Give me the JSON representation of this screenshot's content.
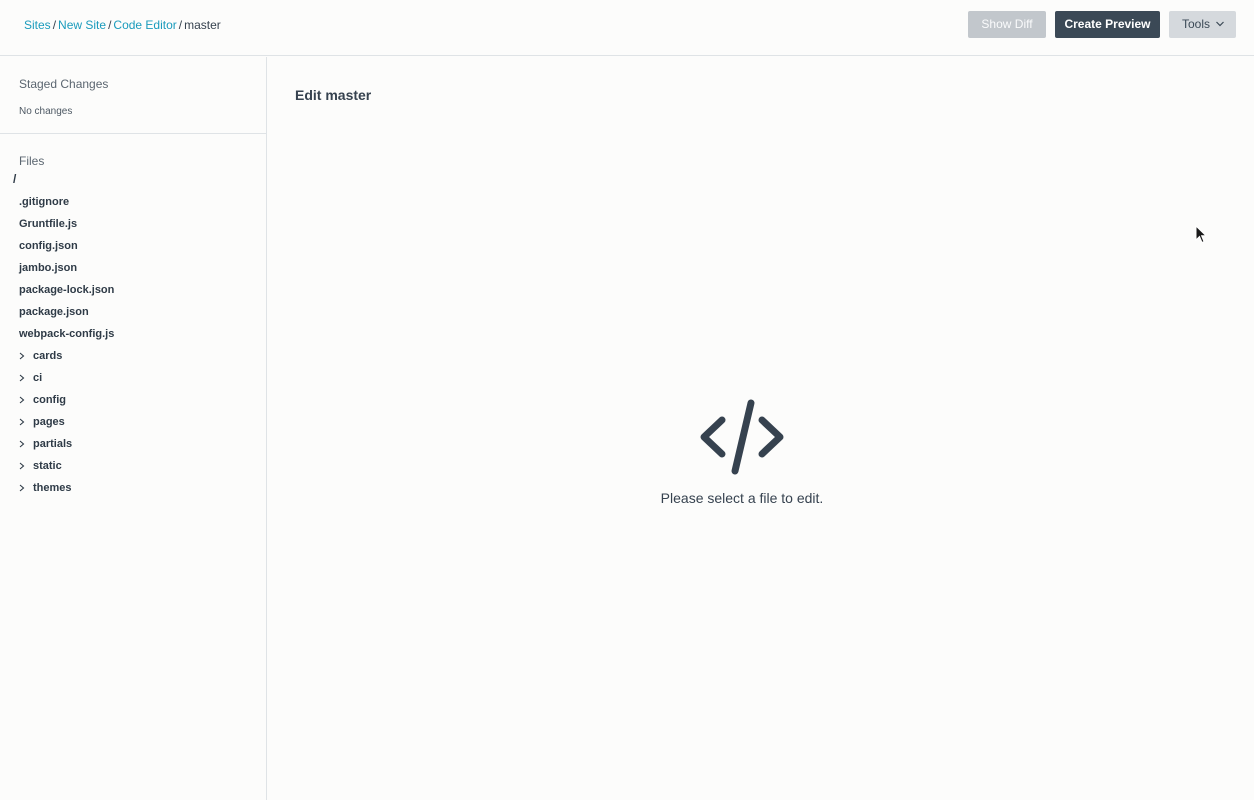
{
  "breadcrumb": {
    "items": [
      "Sites",
      "New Site",
      "Code Editor"
    ],
    "separator": "/",
    "current": "master"
  },
  "toolbar": {
    "show_diff": "Show Diff",
    "create_preview": "Create Preview",
    "tools": "Tools"
  },
  "sidebar": {
    "staged_title": "Staged Changes",
    "no_changes": "No changes",
    "files_title": "Files",
    "root": "/",
    "files": [
      ".gitignore",
      "Gruntfile.js",
      "config.json",
      "jambo.json",
      "package-lock.json",
      "package.json",
      "webpack-config.js"
    ],
    "folders": [
      "cards",
      "ci",
      "config",
      "pages",
      "partials",
      "static",
      "themes"
    ]
  },
  "main": {
    "title": "Edit master",
    "empty_message": "Please select a file to edit.",
    "empty_icon": "code-icon"
  },
  "colors": {
    "link": "#1a9bbc",
    "primary_button": "#3b4956",
    "disabled_button": "#c2c7cc",
    "text": "#36424f"
  }
}
